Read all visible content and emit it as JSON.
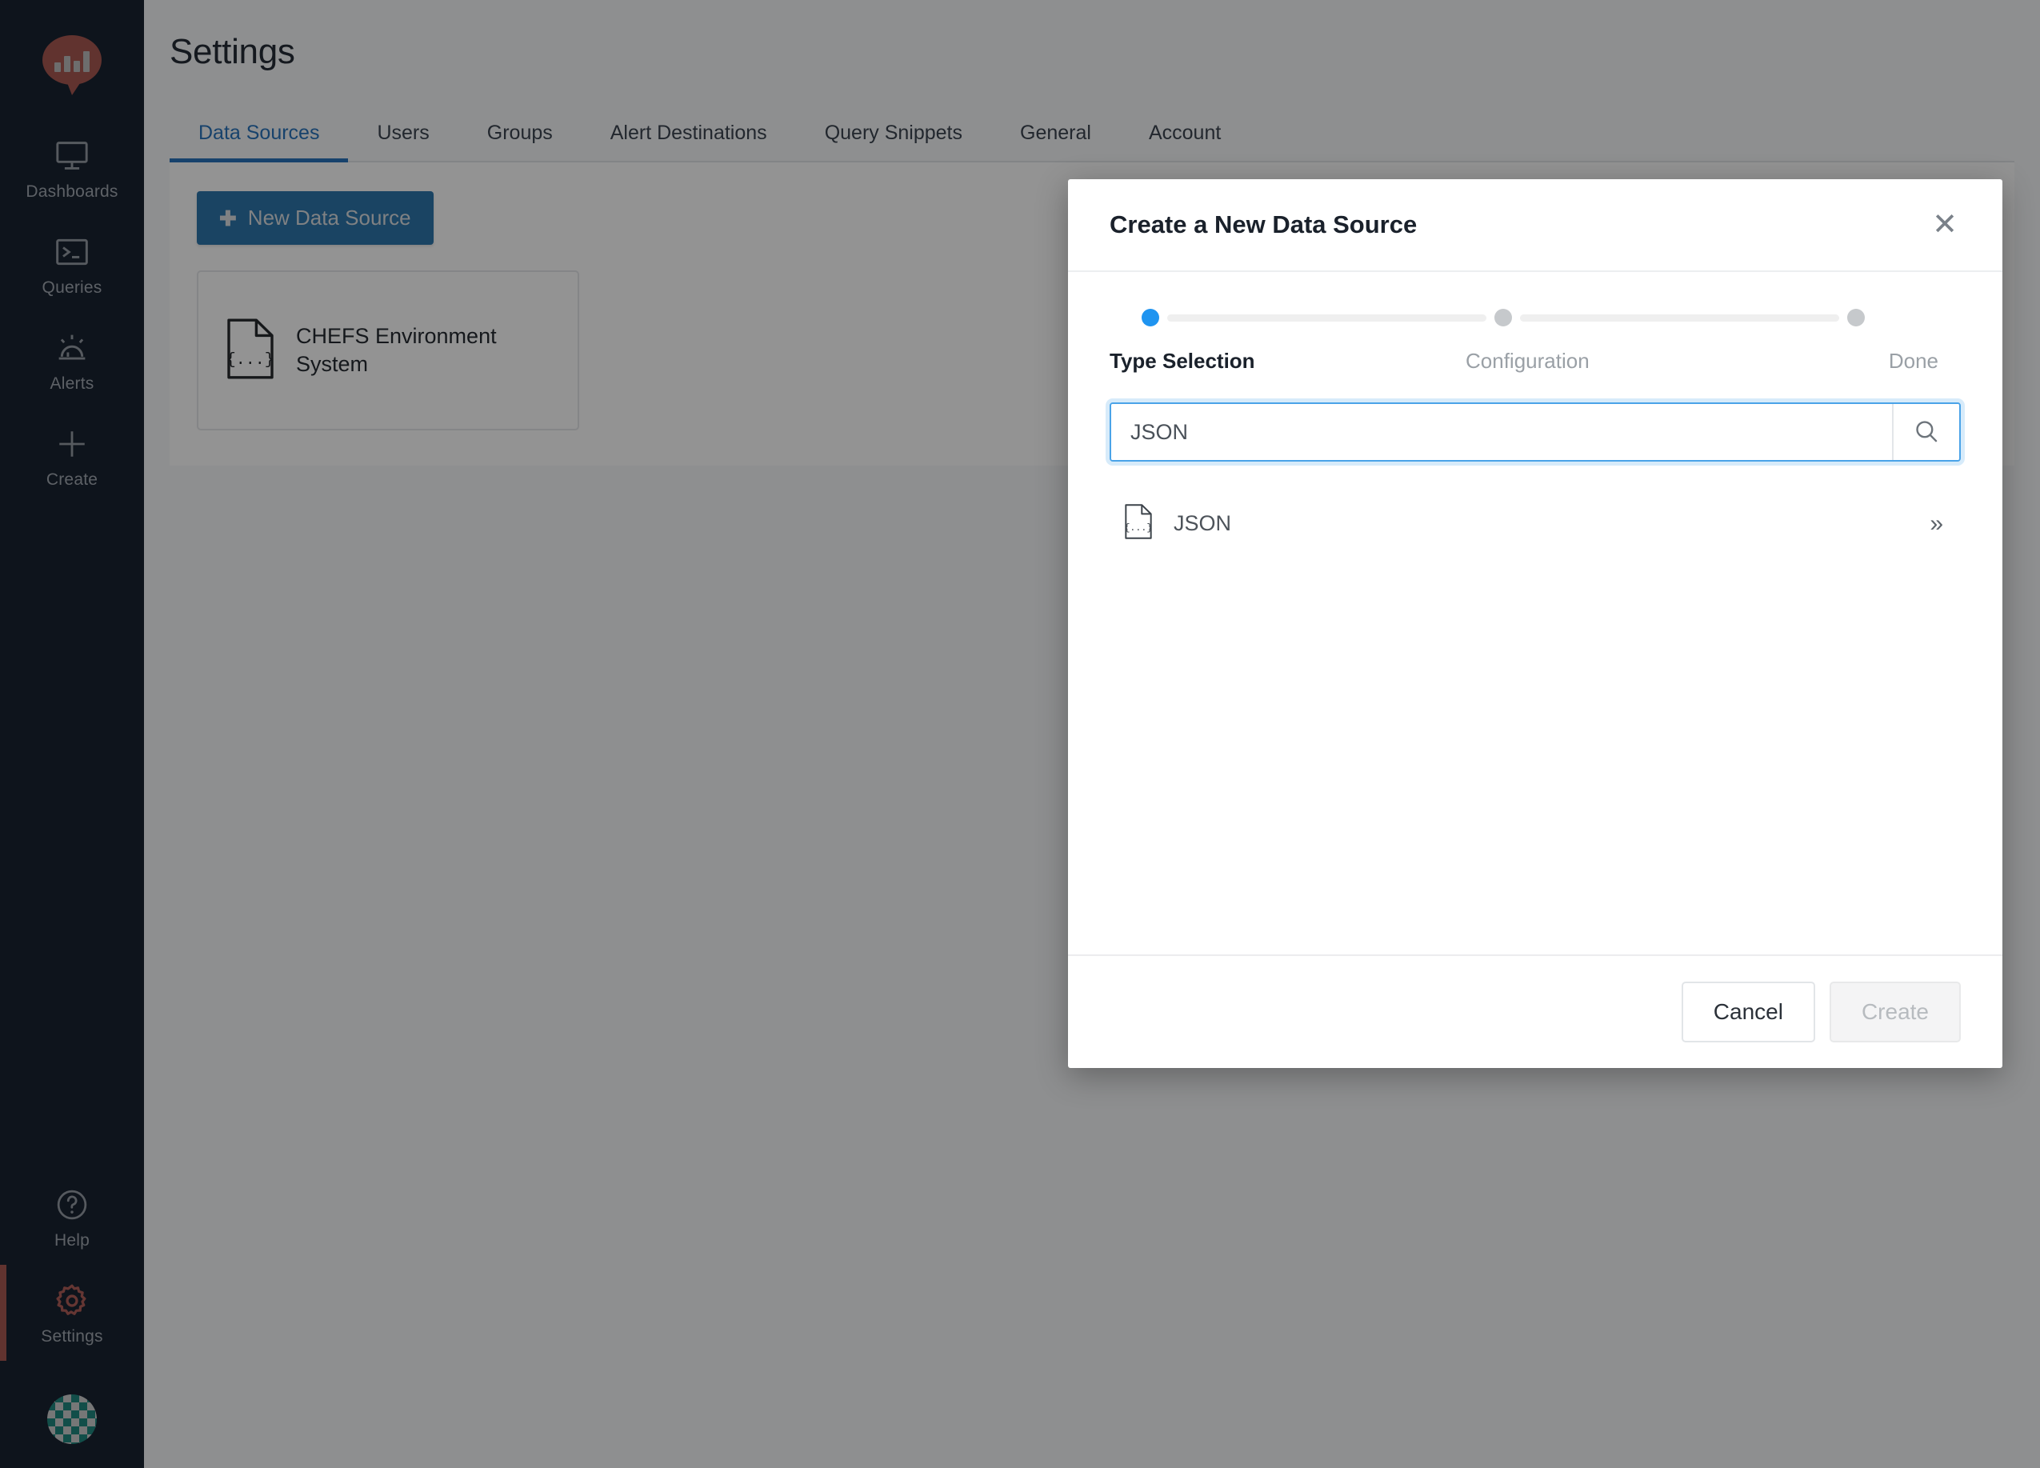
{
  "sidebar": {
    "logo_name": "redash-logo",
    "items": [
      {
        "label": "Dashboards",
        "icon": "monitor-icon",
        "active": false
      },
      {
        "label": "Queries",
        "icon": "terminal-icon",
        "active": false
      },
      {
        "label": "Alerts",
        "icon": "alert-bell-icon",
        "active": false
      },
      {
        "label": "Create",
        "icon": "plus-icon",
        "active": false
      }
    ],
    "bottom_items": [
      {
        "label": "Help",
        "icon": "question-circle-icon",
        "active": false
      },
      {
        "label": "Settings",
        "icon": "gear-icon",
        "active": true
      }
    ],
    "avatar_name": "user-avatar",
    "active_accent": "#a04a42"
  },
  "page": {
    "title": "Settings",
    "accent": "#1567b5"
  },
  "tabs": [
    {
      "label": "Data Sources",
      "active": true
    },
    {
      "label": "Users",
      "active": false
    },
    {
      "label": "Groups",
      "active": false
    },
    {
      "label": "Alert Destinations",
      "active": false
    },
    {
      "label": "Query Snippets",
      "active": false
    },
    {
      "label": "General",
      "active": false
    },
    {
      "label": "Account",
      "active": false
    }
  ],
  "data_sources": {
    "new_button_label": "New Data Source",
    "new_button_icon": "plus-icon",
    "cards": [
      {
        "name": "CHEFS Environment System",
        "icon": "json-file-icon"
      }
    ]
  },
  "modal": {
    "title": "Create a New Data Source",
    "close_icon": "close-icon",
    "stepper": {
      "steps": [
        {
          "label": "Type Selection",
          "state": "current"
        },
        {
          "label": "Configuration",
          "state": "pending"
        },
        {
          "label": "Done",
          "state": "pending"
        }
      ],
      "active_color": "#1f94f0",
      "pending_color": "#c6c9cc"
    },
    "search": {
      "value": "JSON",
      "placeholder": "",
      "button_icon": "search-icon"
    },
    "results": [
      {
        "label": "JSON",
        "icon": "json-file-icon",
        "chevron": "»"
      }
    ],
    "footer": {
      "cancel_label": "Cancel",
      "create_label": "Create",
      "create_disabled": true
    }
  }
}
